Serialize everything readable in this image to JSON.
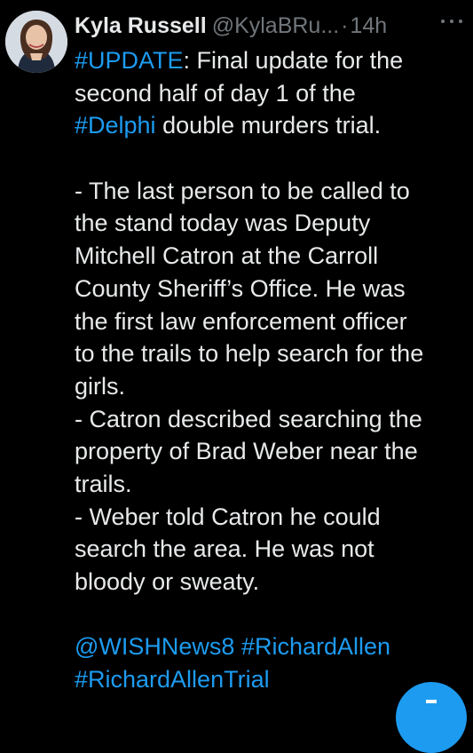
{
  "tweet": {
    "author": {
      "display_name": "Kyla Russell",
      "handle": "@KylaBRu...",
      "separator": "·",
      "time": "14h"
    },
    "more_icon": "ellipsis-icon",
    "lines": [
      {
        "parts": [
          {
            "t": "#UPDATE",
            "link": true
          },
          {
            "t": ": Final update for the",
            "link": false
          }
        ]
      },
      {
        "parts": [
          {
            "t": "second half of day 1 of the",
            "link": false
          }
        ]
      },
      {
        "parts": [
          {
            "t": "#Delphi",
            "link": true
          },
          {
            "t": " double murders trial.",
            "link": false
          }
        ]
      },
      {
        "blank": true
      },
      {
        "parts": [
          {
            "t": "- The last person to be called to",
            "link": false
          }
        ]
      },
      {
        "parts": [
          {
            "t": "the stand today was Deputy",
            "link": false
          }
        ]
      },
      {
        "parts": [
          {
            "t": "Mitchell Catron at the Carroll",
            "link": false
          }
        ]
      },
      {
        "parts": [
          {
            "t": "County Sheriff’s Office. He was",
            "link": false
          }
        ]
      },
      {
        "parts": [
          {
            "t": "the first law enforcement officer",
            "link": false
          }
        ]
      },
      {
        "parts": [
          {
            "t": "to the trails to help search for the",
            "link": false
          }
        ]
      },
      {
        "parts": [
          {
            "t": "girls.",
            "link": false
          }
        ]
      },
      {
        "parts": [
          {
            "t": "- Catron described searching the",
            "link": false
          }
        ]
      },
      {
        "parts": [
          {
            "t": "property of Brad Weber near the",
            "link": false
          }
        ]
      },
      {
        "parts": [
          {
            "t": "trails.",
            "link": false
          }
        ]
      },
      {
        "parts": [
          {
            "t": "- Weber told Catron he could",
            "link": false
          }
        ]
      },
      {
        "parts": [
          {
            "t": "search the area. He was not",
            "link": false
          }
        ]
      },
      {
        "parts": [
          {
            "t": "bloody or sweaty.",
            "link": false
          }
        ]
      },
      {
        "blank": true
      },
      {
        "parts": [
          {
            "t": "@WISHNews8",
            "link": true
          },
          {
            "t": " ",
            "link": false
          },
          {
            "t": "#RichardAllen",
            "link": true
          }
        ]
      },
      {
        "parts": [
          {
            "t": "#RichardAllenTrial",
            "link": true
          }
        ]
      }
    ]
  },
  "compose_button": {
    "icon": "plus-icon"
  },
  "colors": {
    "background": "#000000",
    "text": "#e7e9ea",
    "muted": "#71767b",
    "link": "#1d9bf0"
  }
}
